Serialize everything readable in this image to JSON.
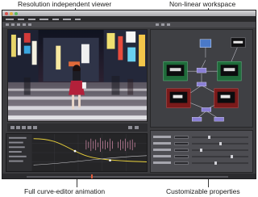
{
  "callouts": {
    "top_left": "Resolution independent viewer",
    "top_right": "Non-linear workspace",
    "bottom_left": "Full curve-editor animation",
    "bottom_right": "Customizable properties"
  },
  "colors": {
    "window_bg": "#3b3b3e",
    "node_green": "#1f6b3a",
    "node_red": "#7a1a1a",
    "node_blue": "#4a79c8",
    "node_purple": "#8a7fd4",
    "curve_yellow": "#e8d03a",
    "waveform_pink": "#d98fae"
  }
}
